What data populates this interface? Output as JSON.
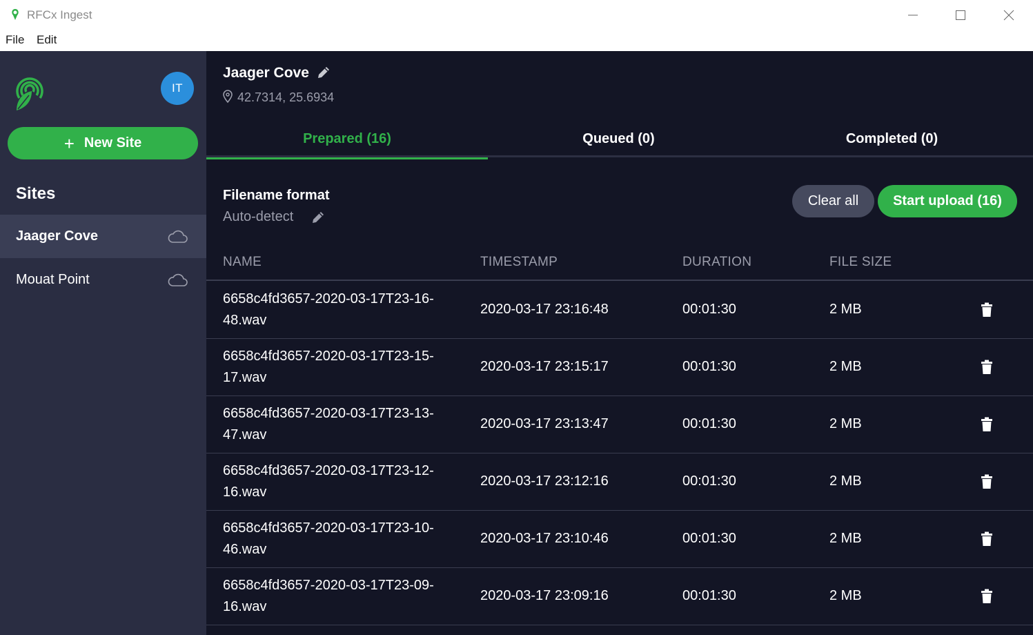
{
  "window": {
    "title": "RFCx Ingest",
    "menu": [
      "File",
      "Edit"
    ]
  },
  "colors": {
    "accent": "#31b14a",
    "sidebar": "#2a2d42",
    "main_bg": "#131525",
    "avatar": "#2b8fdc"
  },
  "sidebar": {
    "avatar_initials": "IT",
    "new_site_label": "New Site",
    "sites_heading": "Sites",
    "sites": [
      {
        "label": "Jaager Cove",
        "active": true
      },
      {
        "label": "Mouat Point",
        "active": false
      }
    ]
  },
  "site": {
    "title": "Jaager Cove",
    "coordinates": "42.7314, 25.6934"
  },
  "tabs": [
    {
      "label": "Prepared (16)",
      "active": true
    },
    {
      "label": "Queued (0)",
      "active": false
    },
    {
      "label": "Completed (0)",
      "active": false
    }
  ],
  "filename_format": {
    "label": "Filename format",
    "value": "Auto-detect"
  },
  "actions": {
    "clear_all": "Clear all",
    "start_upload": "Start upload (16)"
  },
  "table": {
    "columns": [
      "NAME",
      "TIMESTAMP",
      "DURATION",
      "FILE SIZE"
    ],
    "rows": [
      {
        "name": "6658c4fd3657-2020-03-17T23-16-48.wav",
        "timestamp": "2020-03-17 23:16:48",
        "duration": "00:01:30",
        "size": "2 MB"
      },
      {
        "name": "6658c4fd3657-2020-03-17T23-15-17.wav",
        "timestamp": "2020-03-17 23:15:17",
        "duration": "00:01:30",
        "size": "2 MB"
      },
      {
        "name": "6658c4fd3657-2020-03-17T23-13-47.wav",
        "timestamp": "2020-03-17 23:13:47",
        "duration": "00:01:30",
        "size": "2 MB"
      },
      {
        "name": "6658c4fd3657-2020-03-17T23-12-16.wav",
        "timestamp": "2020-03-17 23:12:16",
        "duration": "00:01:30",
        "size": "2 MB"
      },
      {
        "name": "6658c4fd3657-2020-03-17T23-10-46.wav",
        "timestamp": "2020-03-17 23:10:46",
        "duration": "00:01:30",
        "size": "2 MB"
      },
      {
        "name": "6658c4fd3657-2020-03-17T23-09-16.wav",
        "timestamp": "2020-03-17 23:09:16",
        "duration": "00:01:30",
        "size": "2 MB"
      }
    ]
  }
}
